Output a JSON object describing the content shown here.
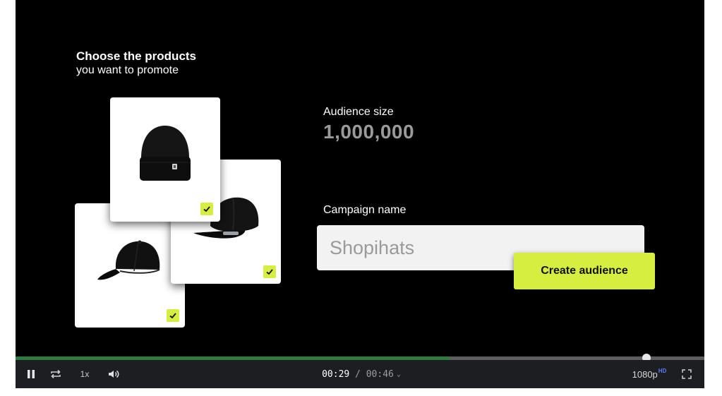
{
  "heading": {
    "title": "Choose the products",
    "subtitle": "you want to promote"
  },
  "products": [
    {
      "name": "Beanie",
      "selected": true,
      "icon": "beanie-image"
    },
    {
      "name": "Snapback hat",
      "selected": true,
      "icon": "snapback-image"
    },
    {
      "name": "Baseball cap",
      "selected": true,
      "icon": "baseball-cap-image"
    }
  ],
  "audience": {
    "label": "Audience size",
    "value": "1,000,000"
  },
  "campaign": {
    "label": "Campaign name",
    "value": "Shopihats"
  },
  "create_button": {
    "label": "Create audience"
  },
  "player": {
    "progress": 0.63,
    "speed": "1x",
    "current_time": "00:29",
    "separator": " / ",
    "total_time": "00:46",
    "quality": "1080p",
    "quality_badge": "HD",
    "icons": [
      "pause-icon",
      "loop-icon",
      "volume-icon",
      "chevron-down-icon",
      "fullscreen-icon"
    ]
  },
  "colors": {
    "accent": "#d6ee3f",
    "progress": "#2e7a43",
    "background": "#000000",
    "controls_bg": "#1c1e22"
  }
}
